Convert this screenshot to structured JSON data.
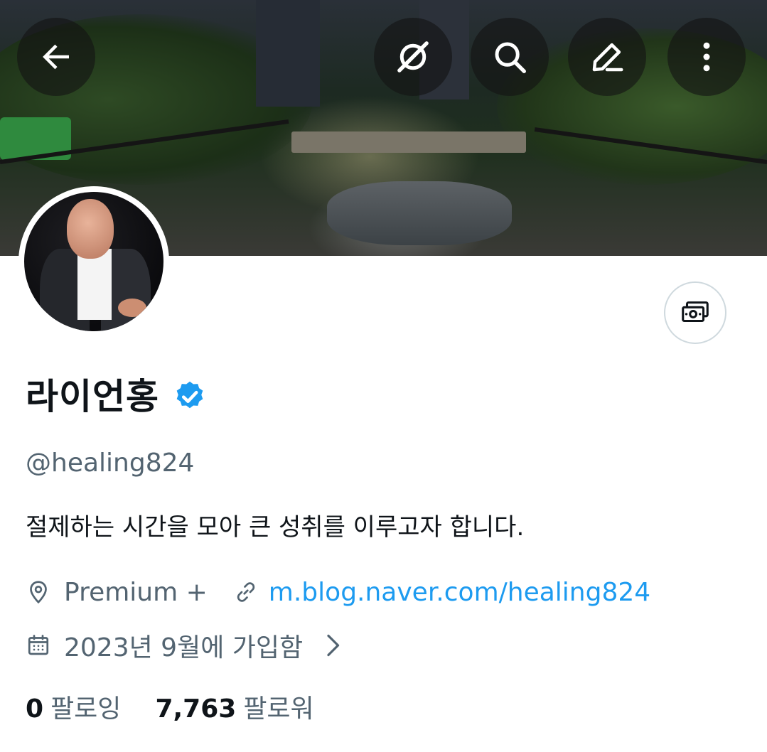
{
  "profile": {
    "name": "라이언홍",
    "handle": "@healing824",
    "bio": "절제하는 시간을 모아 큰 성취를 이루고자 합니다.",
    "location": "Premium +",
    "link": "m.blog.naver.com/healing824",
    "joined": "2023년 9월에 가입함",
    "following_count": "0",
    "following_label": "팔로잉",
    "followers_count": "7,763",
    "followers_label": "팔로워"
  },
  "icons": {
    "back": "arrow-left-icon",
    "grok": "grok-icon",
    "search": "search-icon",
    "edit": "pencil-icon",
    "more": "more-vertical-icon",
    "subscribe": "money-icon",
    "verified": "verified-badge-icon",
    "location": "location-pin-icon",
    "link": "link-icon",
    "calendar": "calendar-icon",
    "chevron": "chevron-right-icon"
  },
  "colors": {
    "accent": "#1d9bf0",
    "secondary_text": "#536471",
    "primary_text": "#0f1419"
  }
}
